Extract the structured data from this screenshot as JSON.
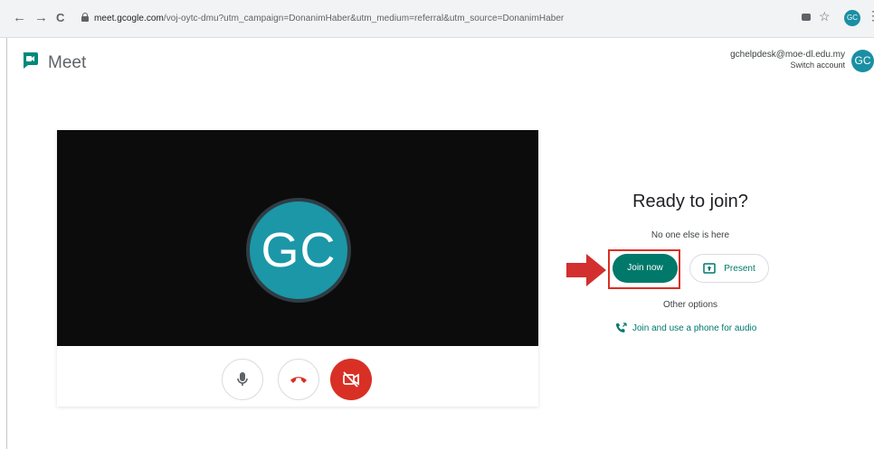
{
  "browser": {
    "back_icon": "←",
    "forward_icon": "→",
    "reload_icon": "C",
    "url_domain": "meet.gcogle.com",
    "url_path": "/voj-oytc-dmu?utm_campaign=DonanimHaber&utm_medium=referral&utm_source=DonanimHaber",
    "star_icon": "☆",
    "avatar_initials": "GC",
    "menu_icon": "⋮"
  },
  "header": {
    "app_name": "Meet",
    "account_email": "gchelpdesk@moe-dl.edu.my",
    "switch_account": "Switch account",
    "avatar_initials": "GC"
  },
  "preview": {
    "avatar_initials": "GC",
    "camera_off": true
  },
  "join_panel": {
    "title": "Ready to join?",
    "status": "No one else is here",
    "join_label": "Join now",
    "present_label": "Present",
    "other_options": "Other options",
    "phone_label": "Join and use a phone for audio"
  },
  "colors": {
    "accent": "#00796b",
    "avatar": "#1b97a8",
    "danger": "#d93025",
    "preview_bg": "#0c0c0c"
  }
}
